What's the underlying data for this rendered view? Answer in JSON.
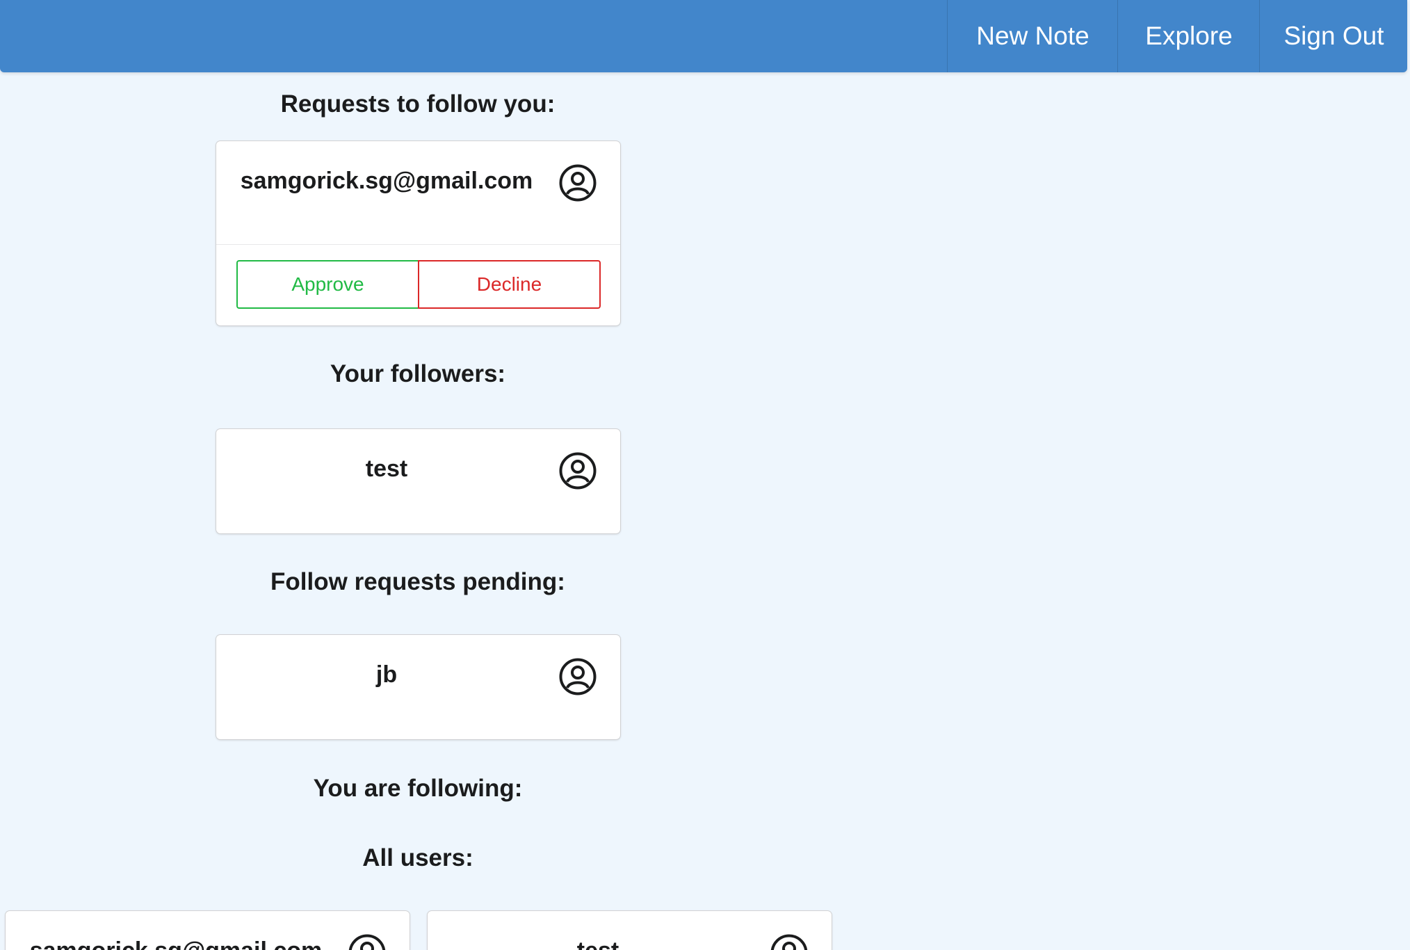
{
  "nav": {
    "new_note": "New Note",
    "explore": "Explore",
    "sign_out": "Sign Out"
  },
  "sections": {
    "requests_to_follow": "Requests to follow you:",
    "followers": "Your followers:",
    "pending": "Follow requests pending:",
    "following": "You are following:",
    "all_users": "All users:"
  },
  "follow_requests": [
    {
      "name": "samgorick.sg@gmail.com",
      "icon": "user-circle-icon",
      "approve_label": "Approve",
      "decline_label": "Decline"
    }
  ],
  "followers": [
    {
      "name": "test",
      "icon": "user-circle-icon"
    }
  ],
  "pending_requests": [
    {
      "name": "jb",
      "icon": "user-circle-icon"
    }
  ],
  "all_users": [
    {
      "name": "samgorick.sg@gmail.com",
      "icon": "user-circle-icon"
    },
    {
      "name": "test",
      "icon": "user-circle-icon"
    }
  ],
  "colors": {
    "menu_bg": "#4286cb",
    "page_bg": "#eef6fd",
    "approve": "#21ba45",
    "decline": "#db2828"
  }
}
